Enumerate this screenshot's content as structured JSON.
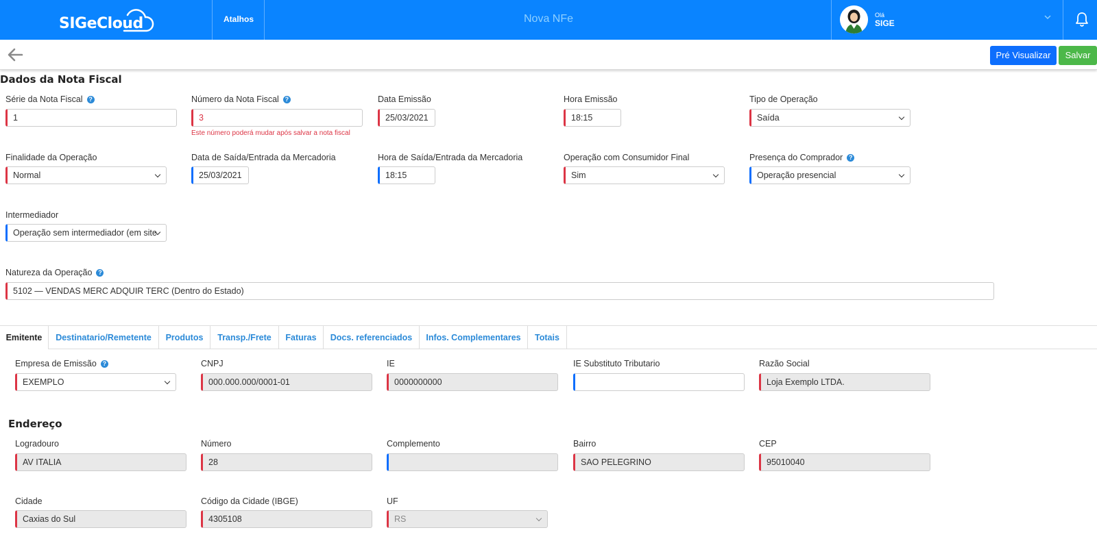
{
  "header": {
    "logo_text": "SIGeCloud",
    "shortcuts": "Atalhos",
    "title": "Nova NFe",
    "greeting": "Olá",
    "user": "SIGE"
  },
  "actions": {
    "preview": "Pré Visualizar",
    "save": "Salvar"
  },
  "invoice": {
    "section_title": "Dados da Nota Fiscal",
    "serie": {
      "label": "Série da Nota Fiscal",
      "value": "1"
    },
    "numero": {
      "label": "Número da Nota Fiscal",
      "value": "3",
      "hint": "Este número poderá mudar após salvar a nota fiscal"
    },
    "data_emissao": {
      "label": "Data Emissão",
      "value": "25/03/2021"
    },
    "hora_emissao": {
      "label": "Hora Emissão",
      "value": "18:15"
    },
    "tipo_operacao": {
      "label": "Tipo de Operação",
      "value": "Saída"
    },
    "finalidade": {
      "label": "Finalidade da Operação",
      "value": "Normal"
    },
    "data_saida": {
      "label": "Data de Saída/Entrada da Mercadoria",
      "value": "25/03/2021"
    },
    "hora_saida": {
      "label": "Hora de Saída/Entrada da Mercadoria",
      "value": "18:15"
    },
    "consumidor_final": {
      "label": "Operação com Consumidor Final",
      "value": "Sim"
    },
    "presenca": {
      "label": "Presença do Comprador",
      "value": "Operação presencial"
    },
    "intermediador": {
      "label": "Intermediador",
      "value": "Operação sem intermediador (em site"
    },
    "natureza": {
      "label": "Natureza da Operação",
      "value": "5102 — VENDAS MERC ADQUIR TERC (Dentro do Estado)"
    }
  },
  "tabs": [
    "Emitente",
    "Destinatario/Remetente",
    "Produtos",
    "Transp./Frete",
    "Faturas",
    "Docs. referenciados",
    "Infos. Complementares",
    "Totais"
  ],
  "emitente": {
    "empresa": {
      "label": "Empresa de Emissão",
      "value": "EXEMPLO"
    },
    "cnpj": {
      "label": "CNPJ",
      "value": "000.000.000/0001-01"
    },
    "ie": {
      "label": "IE",
      "value": "0000000000"
    },
    "ie_st": {
      "label": "IE Substituto Tributario",
      "value": ""
    },
    "razao": {
      "label": "Razão Social",
      "value": "Loja Exemplo LTDA."
    }
  },
  "endereco": {
    "section_title": "Endereço",
    "logradouro": {
      "label": "Logradouro",
      "value": "AV ITALIA"
    },
    "numero": {
      "label": "Número",
      "value": "28"
    },
    "complemento": {
      "label": "Complemento",
      "value": ""
    },
    "bairro": {
      "label": "Bairro",
      "value": "SAO PELEGRINO"
    },
    "cep": {
      "label": "CEP",
      "value": "95010040"
    },
    "cidade": {
      "label": "Cidade",
      "value": "Caxias do Sul"
    },
    "ibge": {
      "label": "Código da Cidade (IBGE)",
      "value": "4305108"
    },
    "uf": {
      "label": "UF",
      "value": "RS"
    }
  },
  "colors": {
    "brand": "#0a84ff",
    "required": "#dc3545",
    "optional": "#0d6efd",
    "save": "#4cb849",
    "link": "#2b8ad8"
  }
}
